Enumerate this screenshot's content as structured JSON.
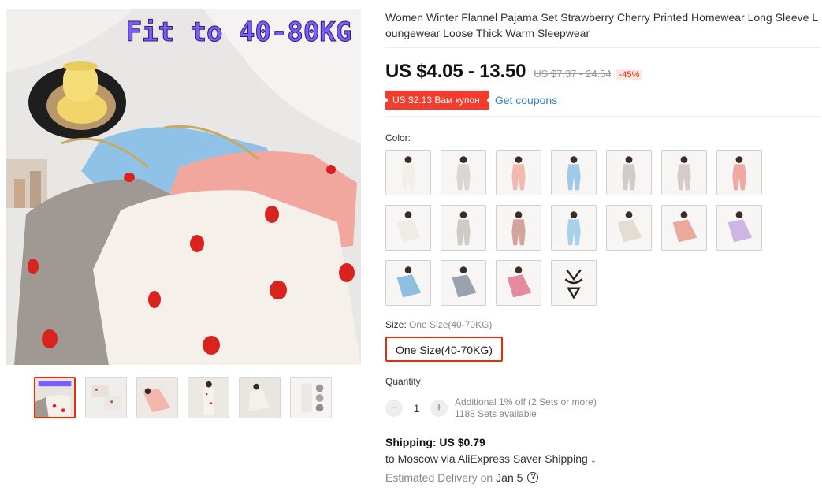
{
  "product": {
    "title": "Women Winter Flannel Pajama Set Strawberry Cherry Printed Homewear Long Sleeve Loungewear Loose Thick Warm Sleepwear",
    "image_overlay_text": "Fit to 40-80KG"
  },
  "price": {
    "current": "US $4.05 - 13.50",
    "original": "US $7.37 - 24.54",
    "discount": "-45%"
  },
  "coupon": {
    "badge": "US $2.13 Вам купон",
    "link": "Get coupons"
  },
  "color": {
    "label": "Color:",
    "swatches": [
      {
        "id": "c1",
        "icon": "pajama-white-print",
        "color": "#f2efe9"
      },
      {
        "id": "c2",
        "icon": "pajama-grey-print",
        "color": "#d9d6d3"
      },
      {
        "id": "c3",
        "icon": "pajama-pink-print",
        "color": "#f2b9b0"
      },
      {
        "id": "c4",
        "icon": "pajama-blue-print",
        "color": "#9fcbe8"
      },
      {
        "id": "c5",
        "icon": "pajama-grey-dots",
        "color": "#d0ccc8"
      },
      {
        "id": "c6",
        "icon": "pajama-mauve",
        "color": "#d8c9cc"
      },
      {
        "id": "c7",
        "icon": "pajama-pink",
        "color": "#f0a8a2"
      },
      {
        "id": "c8",
        "icon": "pajama-white-seated",
        "color": "#efece6"
      },
      {
        "id": "c9",
        "icon": "pajama-grey-figure",
        "color": "#cfcbc7"
      },
      {
        "id": "c10",
        "icon": "pajama-rose",
        "color": "#d6a39a"
      },
      {
        "id": "c11",
        "icon": "pajama-light-blue",
        "color": "#a9d1ec"
      },
      {
        "id": "c12",
        "icon": "pajama-beige-seated",
        "color": "#e3ddd4"
      },
      {
        "id": "c13",
        "icon": "pajama-salmon-seated",
        "color": "#eaa99a"
      },
      {
        "id": "c14",
        "icon": "pajama-lavender-seated",
        "color": "#cdb6e3"
      },
      {
        "id": "c15",
        "icon": "pajama-blue-lying",
        "color": "#8fbfe0"
      },
      {
        "id": "c16",
        "icon": "pajama-grey-lying",
        "color": "#9aa3ad"
      },
      {
        "id": "c17",
        "icon": "pajama-pink-lying",
        "color": "#e78aa0"
      },
      {
        "id": "c18",
        "icon": "lingerie-black",
        "color": "#222222"
      }
    ]
  },
  "size": {
    "label": "Size:",
    "selected": "One Size(40-70KG)",
    "option": "One Size(40-70KG)"
  },
  "quantity": {
    "label": "Quantity:",
    "value": "1",
    "minus": "−",
    "plus": "+",
    "note_discount": "Additional 1% off (2 Sets or more)",
    "note_available": "1188 Sets available"
  },
  "shipping": {
    "cost": "Shipping: US $0.79",
    "destination": "to Moscow via AliExpress Saver Shipping",
    "chevron": "⌄",
    "delivery_label": "Estimated Delivery on",
    "delivery_date": "Jan 5",
    "help": "?"
  },
  "thumbnails": [
    {
      "id": "t1",
      "icon": "thumb-main-photo",
      "active": true
    },
    {
      "id": "t2",
      "icon": "thumb-folded-set"
    },
    {
      "id": "t3",
      "icon": "thumb-pink-model"
    },
    {
      "id": "t4",
      "icon": "thumb-white-model"
    },
    {
      "id": "t5",
      "icon": "thumb-sitting-model"
    },
    {
      "id": "t6",
      "icon": "thumb-fabric-detail"
    }
  ]
}
